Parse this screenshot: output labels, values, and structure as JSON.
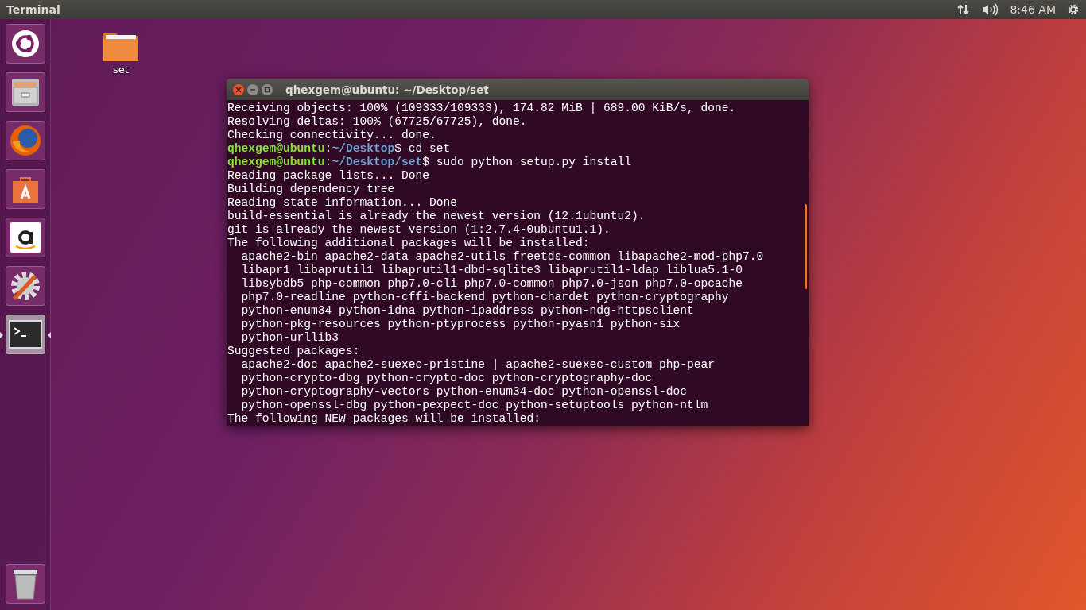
{
  "top_panel": {
    "app_title": "Terminal",
    "clock": "8:46 AM"
  },
  "launcher": {
    "items": [
      {
        "kind": "dash",
        "selected": false
      },
      {
        "kind": "files",
        "selected": false
      },
      {
        "kind": "browser",
        "selected": false
      },
      {
        "kind": "store",
        "selected": false
      },
      {
        "kind": "amazon",
        "selected": false
      },
      {
        "kind": "settings",
        "selected": false
      },
      {
        "kind": "terminal",
        "selected": true
      }
    ],
    "trash": {
      "kind": "trash"
    }
  },
  "desktop_icons": [
    {
      "label": "set"
    }
  ],
  "terminal": {
    "title": "qhexgem@ubuntu: ~/Desktop/set",
    "lines": [
      {
        "kind": "output",
        "text": "Receiving objects: 100% (109333/109333), 174.82 MiB | 689.00 KiB/s, done."
      },
      {
        "kind": "output",
        "text": "Resolving deltas: 100% (67725/67725), done."
      },
      {
        "kind": "output",
        "text": "Checking connectivity... done."
      },
      {
        "kind": "prompt",
        "user": "qhexgem@ubuntu",
        "sep": ":",
        "path": "~/Desktop",
        "tail": "$ cd set"
      },
      {
        "kind": "prompt",
        "user": "qhexgem@ubuntu",
        "sep": ":",
        "path": "~/Desktop/set",
        "tail": "$ sudo python setup.py install"
      },
      {
        "kind": "output",
        "text": "Reading package lists... Done"
      },
      {
        "kind": "output",
        "text": "Building dependency tree"
      },
      {
        "kind": "output",
        "text": "Reading state information... Done"
      },
      {
        "kind": "output",
        "text": "build-essential is already the newest version (12.1ubuntu2)."
      },
      {
        "kind": "output",
        "text": "git is already the newest version (1:2.7.4-0ubuntu1.1)."
      },
      {
        "kind": "output",
        "text": "The following additional packages will be installed:"
      },
      {
        "kind": "output",
        "text": "  apache2-bin apache2-data apache2-utils freetds-common libapache2-mod-php7.0"
      },
      {
        "kind": "output",
        "text": "  libapr1 libaprutil1 libaprutil1-dbd-sqlite3 libaprutil1-ldap liblua5.1-0"
      },
      {
        "kind": "output",
        "text": "  libsybdb5 php-common php7.0-cli php7.0-common php7.0-json php7.0-opcache"
      },
      {
        "kind": "output",
        "text": "  php7.0-readline python-cffi-backend python-chardet python-cryptography"
      },
      {
        "kind": "output",
        "text": "  python-enum34 python-idna python-ipaddress python-ndg-httpsclient"
      },
      {
        "kind": "output",
        "text": "  python-pkg-resources python-ptyprocess python-pyasn1 python-six"
      },
      {
        "kind": "output",
        "text": "  python-urllib3"
      },
      {
        "kind": "output",
        "text": "Suggested packages:"
      },
      {
        "kind": "output",
        "text": "  apache2-doc apache2-suexec-pristine | apache2-suexec-custom php-pear"
      },
      {
        "kind": "output",
        "text": "  python-crypto-dbg python-crypto-doc python-cryptography-doc"
      },
      {
        "kind": "output",
        "text": "  python-cryptography-vectors python-enum34-doc python-openssl-doc"
      },
      {
        "kind": "output",
        "text": "  python-openssl-dbg python-pexpect-doc python-setuptools python-ntlm"
      },
      {
        "kind": "output",
        "text": "The following NEW packages will be installed:"
      }
    ]
  }
}
